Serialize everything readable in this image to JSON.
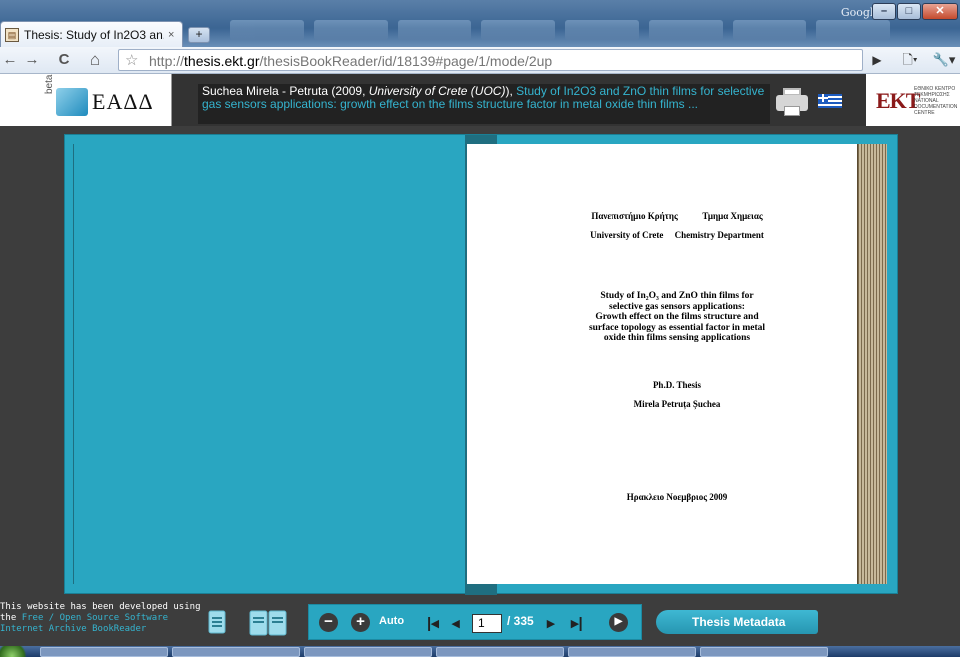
{
  "browser": {
    "tab_title": "Thesis: Study of In2O3 an...",
    "tab_close": "×",
    "new_tab": "+",
    "google_label": "Google",
    "url_host": "thesis.ekt.gr",
    "url_scheme": "http://",
    "url_path": "/thesisBookReader/id/18139#page/1/mode/2up",
    "icons": {
      "back": "←",
      "forward": "→",
      "reload": "C",
      "home": "⌂",
      "star": "☆",
      "go": "▶",
      "page_menu": "🗋▾",
      "tools_menu": "🔧▾"
    }
  },
  "site": {
    "logo_beta": "beta",
    "logo_name": "ΕΑΔΔ",
    "citation_author": "Suchea Mirela - Petruta (2009, ",
    "citation_institution": "University of Crete (UOC)",
    "citation_close": "),",
    "citation_title": "Study of In2O3 and ZnO thin films for selective gas sensors applications: growth effect on the films structure factor in metal oxide thin films ...",
    "ekt_abbr": "EKT",
    "ekt_small": "ΕΘΝΙΚΟ ΚΕΝΤΡΟ ΤΕΚΜΗΡΙΩΣΗΣ NATIONAL DOCUMENTATION CENTRE"
  },
  "document": {
    "university_gr": "Πανεπιστήμιο Κρήτης",
    "department_gr": "Τμημα Χημειας",
    "university_en": "University of Crete",
    "department_en": "Chemistry Department",
    "title_lines": [
      "Study of In₂O₃ and ZnO thin films for",
      "selective gas sensors applications:",
      "Growth effect on the films structure and",
      "surface topology as essential factor in metal",
      "oxide thin films sensing applications"
    ],
    "degree": "Ph.D. Thesis",
    "author": "Mirela Petruța Șuchea",
    "place_date": "Ηρακλειο Νοεμβριος 2009"
  },
  "footer": {
    "credit_prefix": "This website has been developed using the ",
    "credit_link": "Free / Open Source Software Internet Archive BookReader",
    "zoom_out": "−",
    "zoom_in": "+",
    "zoom_mode": "Auto",
    "first": "|◂",
    "prev": "◂",
    "page_current": "1",
    "page_total": "/ 335",
    "next": "▸",
    "last": "▸|",
    "play": "▶",
    "metadata_button": "Thesis Metadata"
  }
}
